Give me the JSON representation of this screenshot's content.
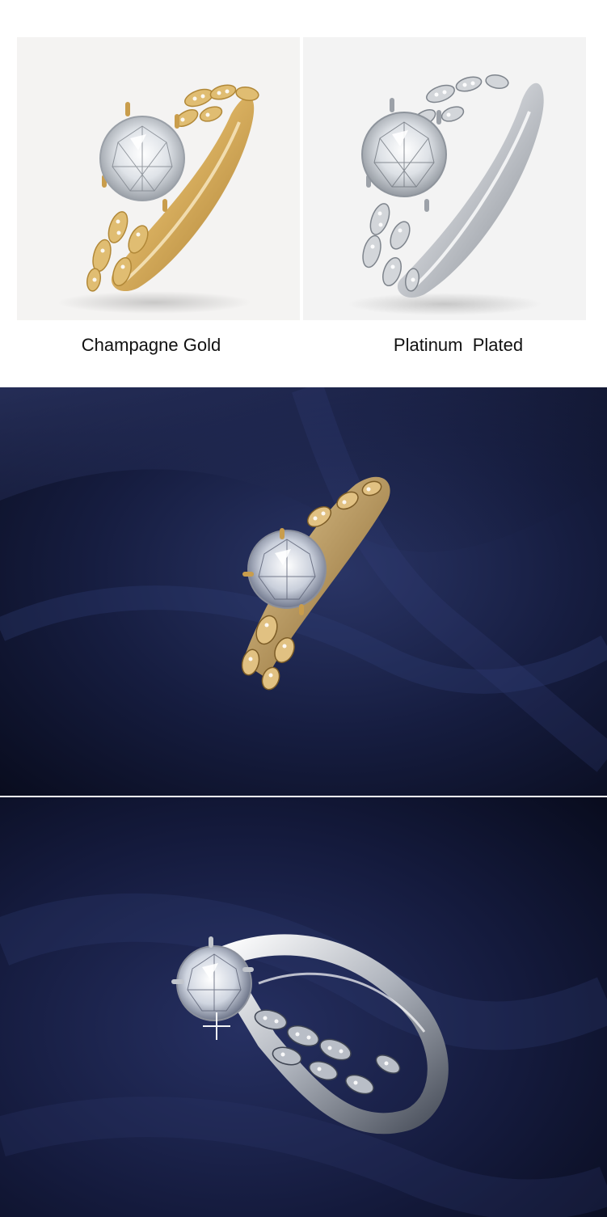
{
  "variants": [
    {
      "label": "Champagne Gold",
      "metal_color": "#d9b46a"
    },
    {
      "label": "Platinum  Plated",
      "metal_color": "#d7d9dc"
    }
  ],
  "photos": [
    {
      "subject": "gold-ring-on-navy-fabric"
    },
    {
      "subject": "platinum-ring-on-navy-fabric"
    }
  ],
  "colors": {
    "page_background": "#ffffff",
    "card_background": "#f4f3f2",
    "fabric_navy": "#141b3a",
    "label_text": "#111111"
  }
}
